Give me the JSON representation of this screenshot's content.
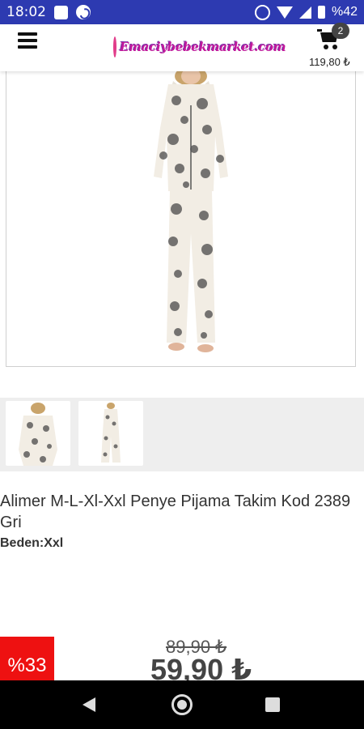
{
  "status_bar": {
    "time": "18:02",
    "battery": "%42"
  },
  "header": {
    "logo_text": "Emaciybebekmarket.com",
    "cart_count": "2",
    "cart_total": "119,80 ₺"
  },
  "product": {
    "title": "Alimer M-L-Xl-Xxl Penye Pijama Takim Kod 2389 Gri",
    "size": "Beden:Xxl",
    "discount": "%33",
    "old_price": "89,90 ₺",
    "new_price": "59,90 ₺"
  },
  "colors": {
    "status_bar": "#2d3ab1",
    "discount": "#ee1111",
    "logo": "#c2189b"
  },
  "icons": [
    "menu-icon",
    "cart-icon",
    "back-icon",
    "home-icon",
    "recents-icon"
  ]
}
